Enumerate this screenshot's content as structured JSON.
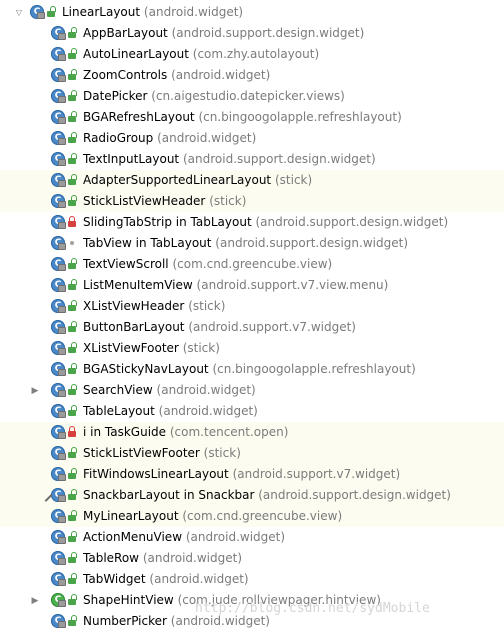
{
  "root": {
    "name": "LinearLayout",
    "package": "(android.widget)",
    "icon": "class-icon",
    "visibility": "public"
  },
  "items": [
    {
      "name": "AppBarLayout",
      "package": "(android.support.design.widget)",
      "icon": "class-icon",
      "visibility": "public"
    },
    {
      "name": "AutoLinearLayout",
      "package": "(com.zhy.autolayout)",
      "icon": "class-icon",
      "visibility": "public"
    },
    {
      "name": "ZoomControls",
      "package": "(android.widget)",
      "icon": "class-icon",
      "visibility": "public"
    },
    {
      "name": "DatePicker",
      "package": "(cn.aigestudio.datepicker.views)",
      "icon": "class-icon",
      "visibility": "public"
    },
    {
      "name": "BGARefreshLayout",
      "package": "(cn.bingoogolapple.refreshlayout)",
      "icon": "class-icon",
      "visibility": "public"
    },
    {
      "name": "RadioGroup",
      "package": "(android.widget)",
      "icon": "class-icon",
      "visibility": "public"
    },
    {
      "name": "TextInputLayout",
      "package": "(android.support.design.widget)",
      "icon": "class-icon",
      "visibility": "public"
    },
    {
      "name": "AdapterSupportedLinearLayout",
      "package": "(stick)",
      "icon": "class-icon",
      "visibility": "public"
    },
    {
      "name": "StickListViewHeader",
      "package": "(stick)",
      "icon": "class-icon",
      "visibility": "public"
    },
    {
      "name": "SlidingTabStrip in TabLayout",
      "package": "(android.support.design.widget)",
      "icon": "class-icon",
      "visibility": "private"
    },
    {
      "name": "TabView in TabLayout",
      "package": "(android.support.design.widget)",
      "icon": "class-icon",
      "visibility": "package"
    },
    {
      "name": "TextViewScroll",
      "package": "(com.cnd.greencube.view)",
      "icon": "class-icon",
      "visibility": "public"
    },
    {
      "name": "ListMenuItemView",
      "package": "(android.support.v7.view.menu)",
      "icon": "class-icon",
      "visibility": "public"
    },
    {
      "name": "XListViewHeader",
      "package": "(stick)",
      "icon": "class-icon",
      "visibility": "public"
    },
    {
      "name": "ButtonBarLayout",
      "package": "(android.support.v7.widget)",
      "icon": "class-icon",
      "visibility": "public"
    },
    {
      "name": "XListViewFooter",
      "package": "(stick)",
      "icon": "class-icon",
      "visibility": "public"
    },
    {
      "name": "BGAStickyNavLayout",
      "package": "(cn.bingoogolapple.refreshlayout)",
      "icon": "class-icon",
      "visibility": "public"
    },
    {
      "name": "SearchView",
      "package": "(android.widget)",
      "icon": "class-icon",
      "visibility": "public",
      "expandable": true
    },
    {
      "name": "TableLayout",
      "package": "(android.widget)",
      "icon": "class-icon",
      "visibility": "public"
    },
    {
      "name": "i in TaskGuide",
      "package": "(com.tencent.open)",
      "icon": "class-icon",
      "visibility": "private"
    },
    {
      "name": "StickListViewFooter",
      "package": "(stick)",
      "icon": "class-icon",
      "visibility": "public"
    },
    {
      "name": "FitWindowsLinearLayout",
      "package": "(android.support.v7.widget)",
      "icon": "class-icon",
      "visibility": "public"
    },
    {
      "name": "SnackbarLayout in Snackbar",
      "package": "(android.support.design.widget)",
      "icon": "class-icon",
      "visibility": "public",
      "pinned": true
    },
    {
      "name": "MyLinearLayout",
      "package": "(com.cnd.greencube.view)",
      "icon": "class-icon",
      "visibility": "public"
    },
    {
      "name": "ActionMenuView",
      "package": "(android.widget)",
      "icon": "class-icon",
      "visibility": "public"
    },
    {
      "name": "TableRow",
      "package": "(android.widget)",
      "icon": "class-icon",
      "visibility": "public"
    },
    {
      "name": "TabWidget",
      "package": "(android.widget)",
      "icon": "class-icon",
      "visibility": "public"
    },
    {
      "name": "ShapeHintView",
      "package": "(com.jude.rollviewpager.hintview)",
      "icon": "class-icon",
      "visibility": "public",
      "expandable": true,
      "icon_variant": "green"
    },
    {
      "name": "NumberPicker",
      "package": "(android.widget)",
      "icon": "class-icon",
      "visibility": "public"
    }
  ],
  "class_icon_letter": "C",
  "expander_symbol": "▶",
  "watermark": "http://blog.csdn.net/sydMobile",
  "colors": {
    "class_icon": "#4a88c7",
    "public_lock": "#4aa54a",
    "private_lock": "#d84040",
    "package_text": "#7b7b7b",
    "alt_row": "#fcfcf1"
  }
}
